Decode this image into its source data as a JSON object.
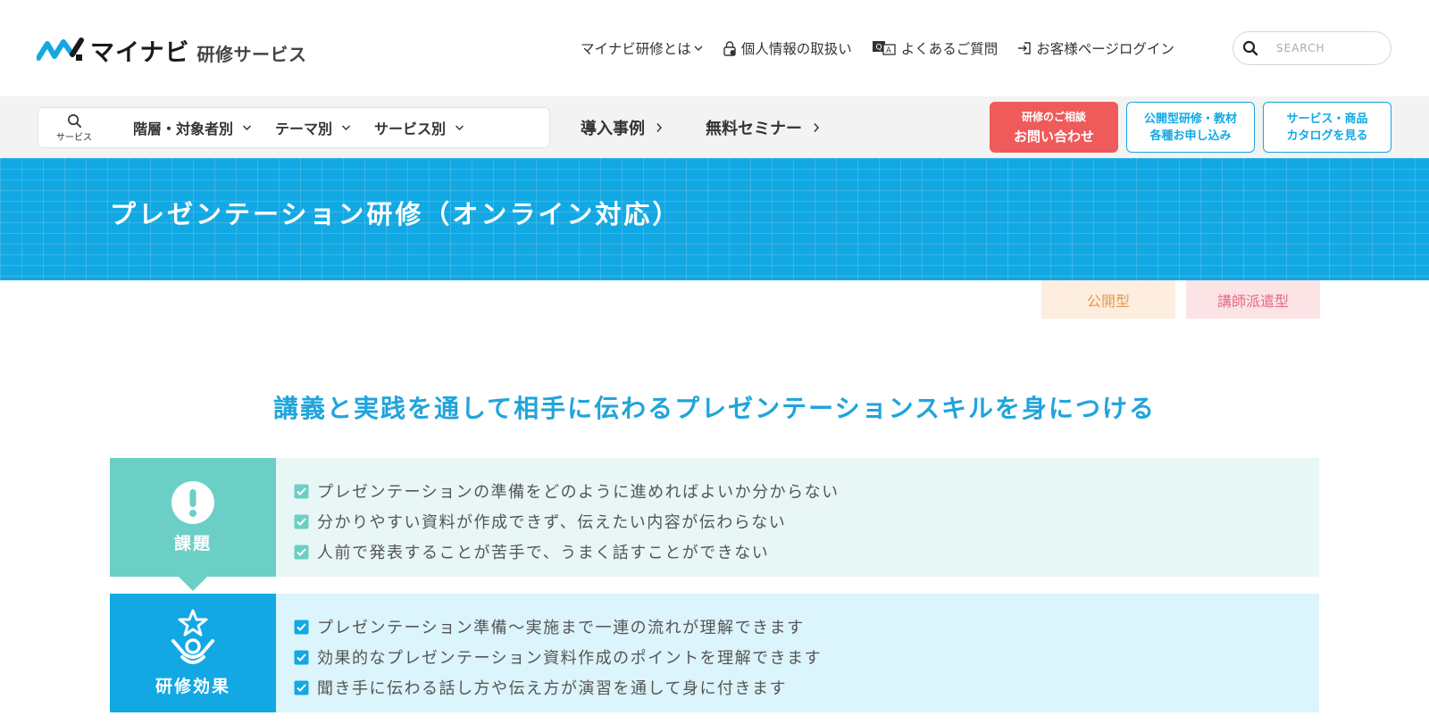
{
  "header": {
    "logo_main": "マイナビ",
    "logo_sub": "研修サービス",
    "util_nav": [
      {
        "label": "マイナビ研修とは",
        "icon": "chevron-down-icon"
      },
      {
        "label": "個人情報の取扱い",
        "icon": "lock-icon"
      },
      {
        "label": "よくあるご質問",
        "icon": "faq-icon"
      },
      {
        "label": "お客様ページログイン",
        "icon": "login-icon"
      }
    ],
    "search": {
      "placeholder": "SEARCH"
    }
  },
  "nav": {
    "search_label": "サービス",
    "categories": [
      "階層・対象者別",
      "テーマ別",
      "サービス別"
    ],
    "links": [
      "導入事例",
      "無料セミナー"
    ],
    "cta_contact": {
      "line1": "研修のご相談",
      "line2": "お問い合わせ"
    },
    "cta_apply": {
      "line1": "公開型研修・教材",
      "line2": "各種お申し込み"
    },
    "cta_catalog": {
      "line1": "サービス・商品",
      "line2": "カタログを見る"
    },
    "colors": {
      "contact": "#ef5a5a",
      "outline": "#13a8e4"
    }
  },
  "banner": {
    "title": "プレゼンテーション研修（オンライン対応）",
    "color": "#12a8e3"
  },
  "tags": [
    "公開型",
    "講師派遣型"
  ],
  "lead": "講義と実践を通して相手に伝わるプレゼンテーションスキルを身につける",
  "problem": {
    "label": "課題",
    "icon": "exclamation-icon",
    "color": "#6ccfc5",
    "items": [
      "プレゼンテーションの準備をどのように進めればよいか分からない",
      "分かりやすい資料が作成できず、伝えたい内容が伝わらない",
      "人前で発表することが苦手で、うまく話すことができない"
    ]
  },
  "effect": {
    "label": "研修効果",
    "icon": "star-person-icon",
    "color": "#12a8e3",
    "items": [
      "プレゼンテーション準備〜実施まで一連の流れが理解できます",
      "効果的なプレゼンテーション資料作成のポイントを理解できます",
      "聞き手に伝わる話し方や伝え方が演習を通して身に付きます"
    ]
  }
}
